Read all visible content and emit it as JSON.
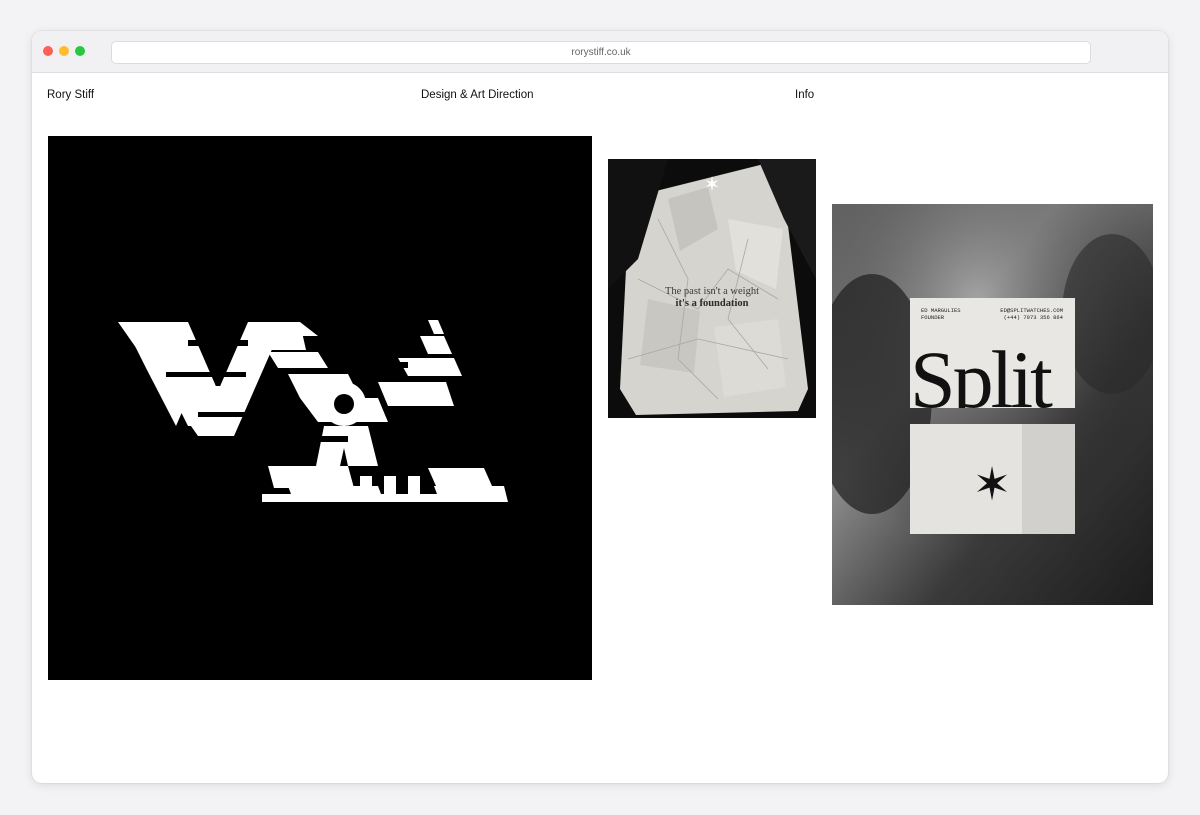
{
  "browser": {
    "url": "rorystiff.co.uk"
  },
  "header": {
    "name": "Rory Stiff",
    "tagline": "Design & Art Direction",
    "info_link": "Info"
  },
  "projects": [
    {
      "art_text": "Vortex glitch wordmark"
    },
    {
      "poster_line1": "The past isn't a weight",
      "poster_line2": "it's a foundation"
    },
    {
      "card_name": "ED MARGULIES",
      "card_role": "FOUNDER",
      "card_email": "ED@SPLITWATCHES.COM",
      "card_phone": "(+44) 7973 356 864",
      "card_wordmark": "Split"
    }
  ],
  "colors": {
    "page_bg": "#f3f3f5",
    "window_bg": "#ffffff",
    "text": "#111111",
    "traffic_red": "#fe5f57",
    "traffic_yellow": "#febc2e",
    "traffic_green": "#28c840"
  }
}
